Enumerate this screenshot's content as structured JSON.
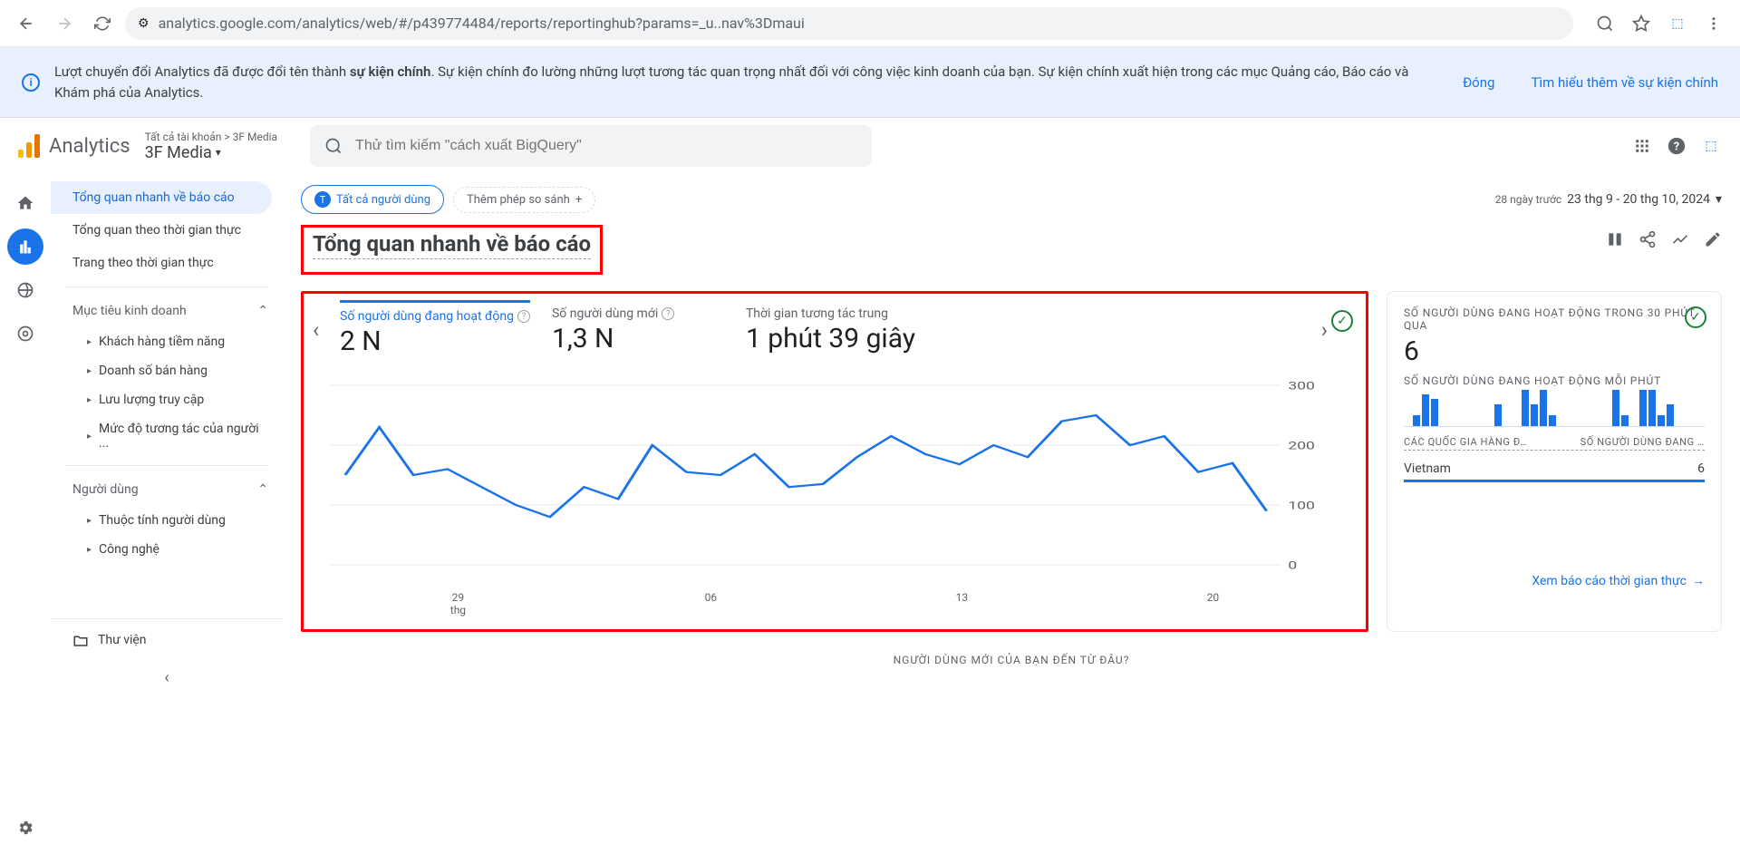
{
  "browser": {
    "url": "analytics.google.com/analytics/web/#/p439774484/reports/reportinghub?params=_u..nav%3Dmaui"
  },
  "notice": {
    "text_pre": "Lượt chuyển đổi Analytics đã được đổi tên thành ",
    "text_bold": "sự kiện chính",
    "text_post": ". Sự kiện chính đo lường những lượt tương tác quan trọng nhất đối với công việc kinh doanh của bạn. Sự kiện chính xuất hiện trong các mục Quảng cáo, Báo cáo và Khám phá của Analytics.",
    "close": "Đóng",
    "learn": "Tìm hiểu thêm về sự kiện chính"
  },
  "header": {
    "analytics": "Analytics",
    "crumb": "Tất cả tài khoản > 3F Media",
    "account": "3F Media",
    "search_placeholder": "Thử tìm kiếm \"cách xuất BigQuery\""
  },
  "sidebar": {
    "items": [
      "Tổng quan nhanh về báo cáo",
      "Tổng quan theo thời gian thực",
      "Trang theo thời gian thực"
    ],
    "group1": "Mục tiêu kinh doanh",
    "group1_items": [
      "Khách hàng tiềm năng",
      "Doanh số bán hàng",
      "Lưu lượng truy cập",
      "Mức độ tương tác của người ..."
    ],
    "group2": "Người dùng",
    "group2_items": [
      "Thuộc tính người dùng",
      "Công nghệ"
    ],
    "library": "Thư viện"
  },
  "top": {
    "all_users": "Tất cả người dùng",
    "add_compare": "Thêm phép so sánh",
    "days_ago": "28 ngày trước",
    "range": "23 thg 9 - 20 thg 10, 2024"
  },
  "title": "Tổng quan nhanh về báo cáo",
  "metrics": {
    "m1_label": "Số người dùng đang hoạt động",
    "m1_value": "2 N",
    "m2_label": "Số người dùng mới",
    "m2_value": "1,3 N",
    "m3_label": "Thời gian tương tác trung",
    "m3_value": "1 phút 39 giây"
  },
  "chart_data": {
    "type": "line",
    "ylabel": "",
    "ylim": [
      0,
      300
    ],
    "y_ticks": [
      0,
      100,
      200,
      300
    ],
    "x_ticks": [
      "29 thg",
      "06",
      "13",
      "20"
    ],
    "values": [
      150,
      230,
      150,
      160,
      130,
      100,
      80,
      130,
      110,
      200,
      155,
      150,
      185,
      130,
      135,
      180,
      215,
      185,
      168,
      200,
      180,
      240,
      250,
      200,
      215,
      155,
      170,
      90
    ]
  },
  "realtime": {
    "label30": "SỐ NGƯỜI DÙNG ĐANG HOẠT ĐỘNG TRONG 30 PHÚT QUA",
    "big": "6",
    "permin": "SỐ NGƯỜI DÙNG ĐANG HOẠT ĐỘNG MỖI PHÚT",
    "bars": [
      0,
      12,
      35,
      30,
      0,
      0,
      0,
      0,
      0,
      0,
      24,
      0,
      0,
      40,
      24,
      40,
      12,
      0,
      0,
      0,
      0,
      0,
      0,
      40,
      12,
      0,
      40,
      40,
      12,
      24
    ],
    "col1": "CÁC QUỐC GIA HÀNG Đ…",
    "col2": "SỐ NGƯỜI DÙNG ĐANG …",
    "row_country": "Vietnam",
    "row_count": "6",
    "link": "Xem báo cáo thời gian thực"
  },
  "footer_q": "NGƯỜI DÙNG MỚI CỦA BẠN ĐẾN TỪ ĐÂU?"
}
